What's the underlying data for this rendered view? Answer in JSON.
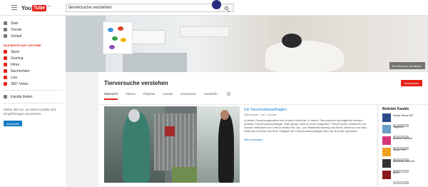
{
  "topbar": {
    "logo_you": "You",
    "logo_tube": "Tube",
    "logo_country": "DE",
    "search_value": "tierversuche verstehen"
  },
  "sidebar": {
    "main_items": [
      {
        "label": "Start",
        "icon": "home-icon"
      },
      {
        "label": "Trends",
        "icon": "flame-icon"
      },
      {
        "label": "Verlauf",
        "icon": "history-icon"
      }
    ],
    "section_heading": "DAS BESTE AUF YOUTUBE",
    "best_items": [
      {
        "label": "Sport",
        "icon": "sport-icon"
      },
      {
        "label": "Gaming",
        "icon": "gaming-icon"
      },
      {
        "label": "Filme",
        "icon": "film-icon"
      },
      {
        "label": "Nachrichten",
        "icon": "news-icon"
      },
      {
        "label": "Live",
        "icon": "live-icon"
      },
      {
        "label": "360°-Video",
        "icon": "360-icon"
      }
    ],
    "browse_channels": "Kanäle finden",
    "signin_note": "Melde dich an, um deine Kanäle und Empfehlungen anzusehen.",
    "signin_button": "Anmelden"
  },
  "banner": {
    "badge": "Tierversuche verstehen"
  },
  "channel": {
    "title": "Tierversuche verstehen",
    "subscribe_label": "Abonnieren",
    "tabs": [
      "Übersicht",
      "Videos",
      "Playlists",
      "Kanäle",
      "Diskussion",
      "Kanalinfo"
    ]
  },
  "featured": {
    "title": "Die Tierschutzbeauftragten",
    "meta": "986 Aufrufe · vor 1 Monat",
    "description": "In jedem Forschungsinstitut und in jeder Behörde, in denen Tierversuche durchgeführt werden, arbeiten Tierschutzbeauftragte. Was genau zählt zu ihren Aufgaben? Tierversuche verstehen hat Gudrun Wittstadt vom Leibniz-Institut für Zoo- und Wildtierforschung und Boris Jerchow vom Max-Delbrück-Centrum bei ihrer Tätigkeit als Tierschutzbeauftragte über die Schulter geschaut.",
    "more": "Mehr anzeigen"
  },
  "related": {
    "heading": "Beliebte Kanäle",
    "items": [
      {
        "name": "Shots Show DE",
        "sub": "Abonnieren",
        "color": "#2b4d8a"
      },
      {
        "name": "TagMoS",
        "sub": "Abonnieren",
        "color": "#6aa0c8"
      },
      {
        "name": "Annica Hansen",
        "sub": "Abonnieren",
        "color": "#d6367a"
      },
      {
        "name": "Junior TM",
        "sub": "Abonnieren",
        "color": "#f0a020"
      },
      {
        "name": "Wiemals Zufucht",
        "sub": "Abonnieren",
        "color": "#333333"
      },
      {
        "name": "MZO",
        "sub": "Abonnieren",
        "color": "#8a1a1a"
      }
    ]
  }
}
